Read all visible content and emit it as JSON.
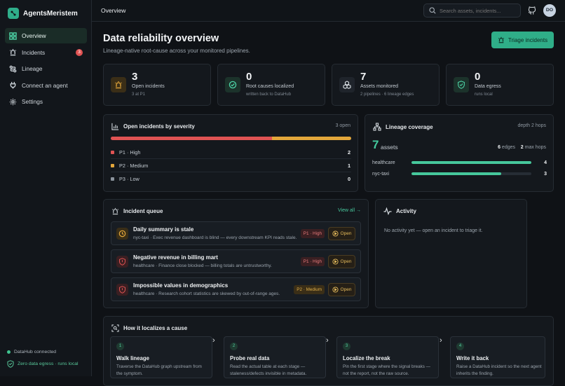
{
  "brand": {
    "name": "AgentsMeristem"
  },
  "nav": [
    {
      "label": "Overview",
      "icon": "grid-icon",
      "active": true
    },
    {
      "label": "Incidents",
      "icon": "siren-icon",
      "badge": "3"
    },
    {
      "label": "Lineage",
      "icon": "route-icon"
    },
    {
      "label": "Connect an agent",
      "icon": "plug-icon"
    },
    {
      "label": "Settings",
      "icon": "gear-icon"
    }
  ],
  "footer": {
    "connected": "DataHub connected",
    "egress": "Zero data egress · runs local"
  },
  "topbar": {
    "title": "Overview",
    "search_placeholder": "Search assets, incidents...",
    "avatar": "DO"
  },
  "page": {
    "title": "Data reliability overview",
    "subtitle": "Lineage-native root-cause across your monitored pipelines.",
    "triage_label": "Triage incidents"
  },
  "stats": [
    {
      "value": "3",
      "label": "Open incidents",
      "sub": "3 at P1",
      "icon": "siren-icon"
    },
    {
      "value": "0",
      "label": "Root causes localized",
      "sub": "written back to DataHub",
      "icon": "check-circle-icon"
    },
    {
      "value": "7",
      "label": "Assets monitored",
      "sub": "2 pipelines · 6 lineage edges",
      "icon": "boxes-icon"
    },
    {
      "value": "0",
      "label": "Data egress",
      "sub": "runs local",
      "icon": "shield-check-icon"
    }
  ],
  "severity": {
    "title": "Open incidents by severity",
    "summary": "3 open",
    "rows": [
      {
        "label": "P1 · High",
        "count": "2",
        "color": "#e05353"
      },
      {
        "label": "P2 · Medium",
        "count": "1",
        "color": "#e3a73b"
      },
      {
        "label": "P3 · Low",
        "count": "0",
        "color": "#8a939c"
      }
    ],
    "bar_fractions": [
      0.67,
      0.33,
      0
    ]
  },
  "coverage": {
    "title": "Lineage coverage",
    "depth": "depth 2 hops",
    "assets_value": "7",
    "assets_unit": "assets",
    "edges_value": "6",
    "edges_label": "edges",
    "hops_value": "2",
    "hops_label": "max hops",
    "rows": [
      {
        "name": "healthcare",
        "value": "4",
        "fraction": 1.0
      },
      {
        "name": "nyc-taxi",
        "value": "3",
        "fraction": 0.75
      }
    ]
  },
  "queue": {
    "title": "Incident queue",
    "view_all": "View all →",
    "open_label": "Open",
    "items": [
      {
        "title": "Daily summary is stale",
        "desc": "nyc-taxi · Exec revenue dashboard is blind — every downstream KPI reads stale.",
        "severity": "P1 · High",
        "sev_class": "p1",
        "icon": "clock-icon",
        "icon_color": "#e3a73b"
      },
      {
        "title": "Negative revenue in billing mart",
        "desc": "healthcare · Finance close blocked — billing totals are untrustworthy.",
        "severity": "P1 · High",
        "sev_class": "p1",
        "icon": "shield-alert-icon",
        "icon_color": "#e05353"
      },
      {
        "title": "Impossible values in demographics",
        "desc": "healthcare · Research cohort statistics are skewed by out-of-range ages.",
        "severity": "P2 · Medium",
        "sev_class": "p2",
        "icon": "shield-alert-icon",
        "icon_color": "#e05353"
      }
    ]
  },
  "activity": {
    "title": "Activity",
    "empty": "No activity yet — open an incident to triage it."
  },
  "how": {
    "title": "How it localizes a cause",
    "steps": [
      {
        "n": "1",
        "title": "Walk lineage",
        "desc": "Traverse the DataHub graph upstream from the symptom."
      },
      {
        "n": "2",
        "title": "Probe real data",
        "desc": "Read the actual table at each stage — staleness/defects invisible in metadata."
      },
      {
        "n": "3",
        "title": "Localize the break",
        "desc": "Pin the first stage where the signal breaks — not the report, not the raw source."
      },
      {
        "n": "4",
        "title": "Write it back",
        "desc": "Raise a DataHub incident so the next agent inherits the finding."
      }
    ]
  }
}
